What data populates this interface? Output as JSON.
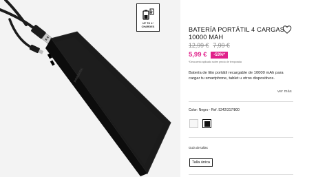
{
  "product": {
    "badge_text": "UP TO 4*\nCHARGES",
    "title": "BATERÍA PORTÁTIL 4 CARGAS 10000 MAH",
    "old_price_1": "12,99 €",
    "old_price_2": "7,99 €",
    "current_price": "5,99 €",
    "discount": "-53%*",
    "discount_note": "*Descuento aplicado sobre precio de temporada",
    "description": "Batería de litio portátil recargable de 10000 mAh para cargar tu smartphone, tablet u otros dispositivos.",
    "more_link": "ver más",
    "color_label": "Color: Negro - Ref. 5242/317/800",
    "size_guide": "Guía de tallas",
    "size_option": "Talla única"
  },
  "icons": {
    "favorite": "heart-icon",
    "badge": "battery-charge-icon"
  },
  "colors": {
    "accent": "#e0218a",
    "swatch_white": "#f7f7f7",
    "swatch_black": "#111111"
  }
}
